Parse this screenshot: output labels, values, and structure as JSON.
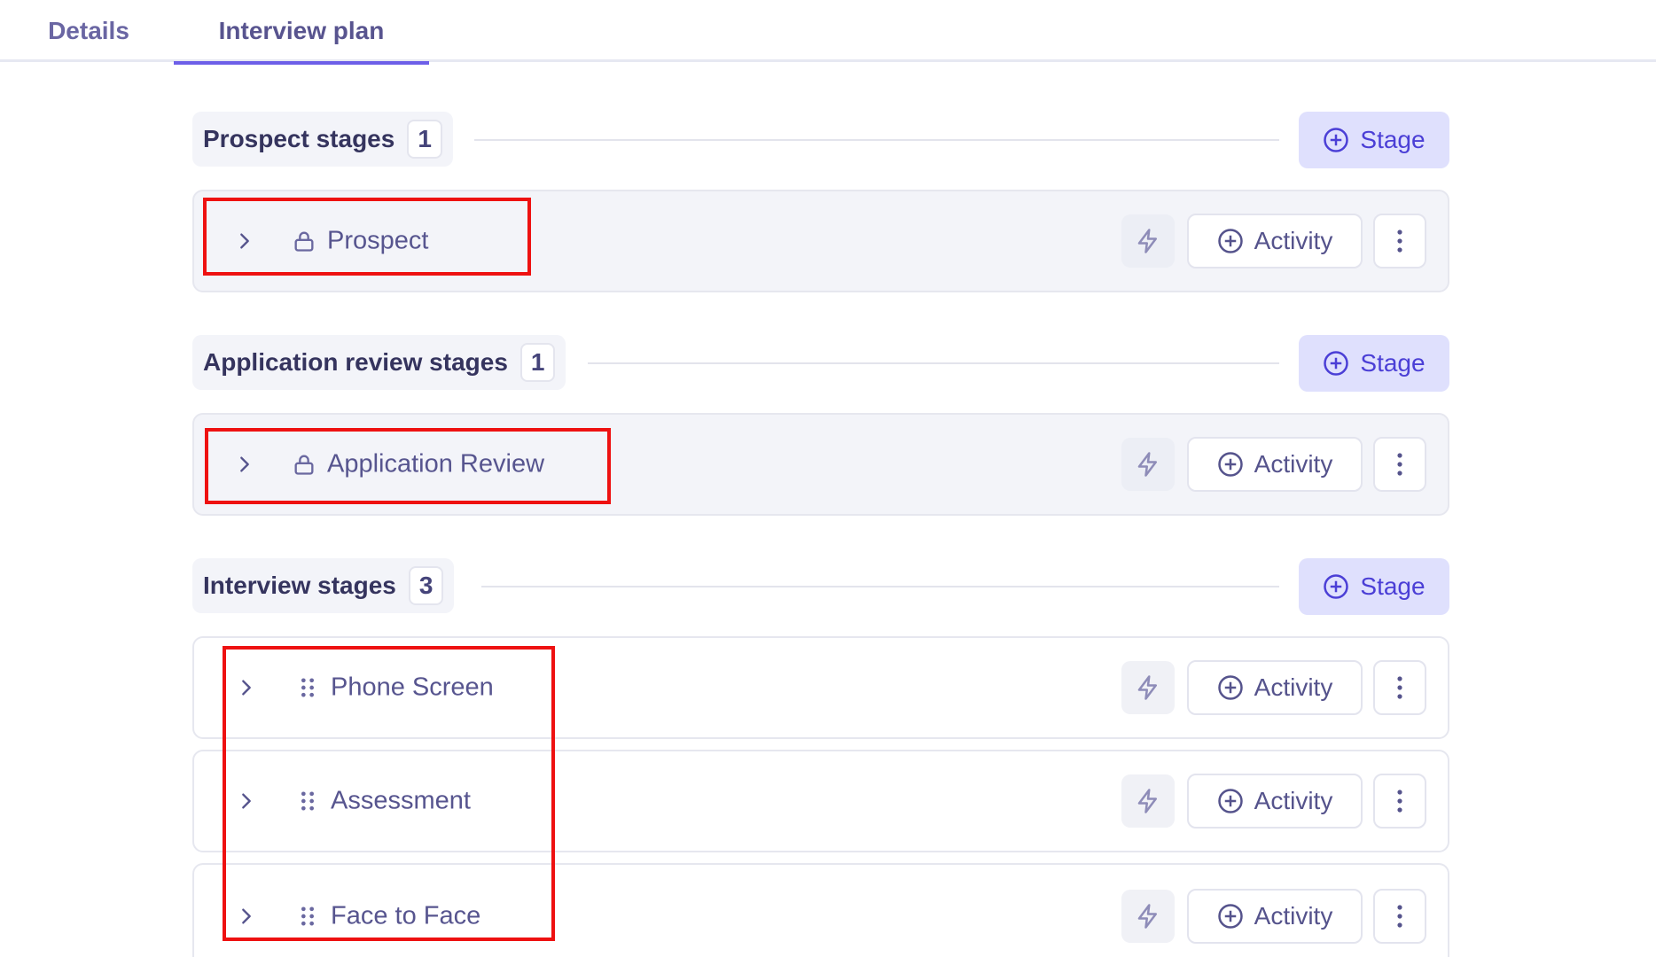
{
  "tabs": [
    {
      "label": "Details"
    },
    {
      "label": "Interview plan"
    }
  ],
  "sections": [
    {
      "title": "Prospect stages",
      "count": "1",
      "stage_button": "Stage",
      "rows": [
        {
          "label": "Prospect",
          "activity_label": "Activity"
        }
      ]
    },
    {
      "title": "Application review stages",
      "count": "1",
      "stage_button": "Stage",
      "rows": [
        {
          "label": "Application Review",
          "activity_label": "Activity"
        }
      ]
    },
    {
      "title": "Interview stages",
      "count": "3",
      "stage_button": "Stage",
      "rows": [
        {
          "label": "Phone Screen",
          "activity_label": "Activity"
        },
        {
          "label": "Assessment",
          "activity_label": "Activity"
        },
        {
          "label": "Face to Face",
          "activity_label": "Activity"
        }
      ]
    }
  ],
  "colors": {
    "accent": "#6d5fe8",
    "highlight": "#ee1111",
    "stage_button_bg": "#dfe0fd"
  },
  "icons": [
    "chevron-right-icon",
    "lock-icon",
    "drag-handle-icon",
    "lightning-icon",
    "plus-circle-icon",
    "more-vertical-icon"
  ]
}
